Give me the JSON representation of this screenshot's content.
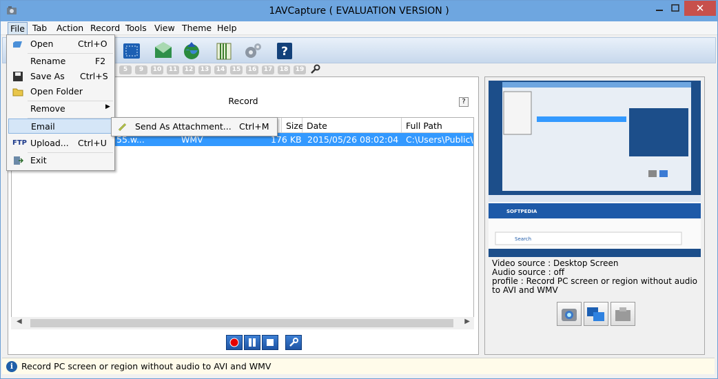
{
  "window": {
    "title": "1AVCapture ( EVALUATION VERSION )"
  },
  "menubar": [
    "File",
    "Tab",
    "Action",
    "Record",
    "Tools",
    "View",
    "Theme",
    "Help"
  ],
  "toolbar_numbers": [
    "5",
    "9",
    "10",
    "11",
    "12",
    "13",
    "14",
    "15",
    "16",
    "17",
    "18",
    "19"
  ],
  "record_panel": {
    "header": "Record",
    "help": "?",
    "columns": [
      "Size",
      "Date",
      "Full Path"
    ],
    "rows": [
      {
        "name": "55.w...",
        "type": "WMV",
        "size": "176 KB",
        "date": "2015/05/26 08:02:04",
        "path": "C:\\Users\\Public\\D"
      }
    ]
  },
  "info": {
    "video_source": "Video source : Desktop Screen",
    "audio_source": "Audio source : off",
    "profile": "profile : Record PC screen or region without audio to AVI and WMV"
  },
  "status": "Record PC screen or region without audio to AVI and WMV",
  "file_menu": {
    "open": {
      "label": "Open",
      "shortcut": "Ctrl+O"
    },
    "rename": {
      "label": "Rename",
      "shortcut": "F2"
    },
    "save_as": {
      "label": "Save As",
      "shortcut": "Ctrl+S"
    },
    "open_folder": {
      "label": "Open Folder"
    },
    "remove": {
      "label": "Remove"
    },
    "email": {
      "label": "Email"
    },
    "upload": {
      "label": "Upload...",
      "shortcut": "Ctrl+U"
    },
    "exit": {
      "label": "Exit"
    }
  },
  "email_submenu": {
    "label": "Send As Attachment...",
    "shortcut": "Ctrl+M"
  },
  "preview_text": {
    "logo": "SOFTPEDIA",
    "search": "Search"
  },
  "colors": {
    "titlebar": "#6ea6e0",
    "selection": "#3399ff",
    "close": "#c7504c"
  }
}
